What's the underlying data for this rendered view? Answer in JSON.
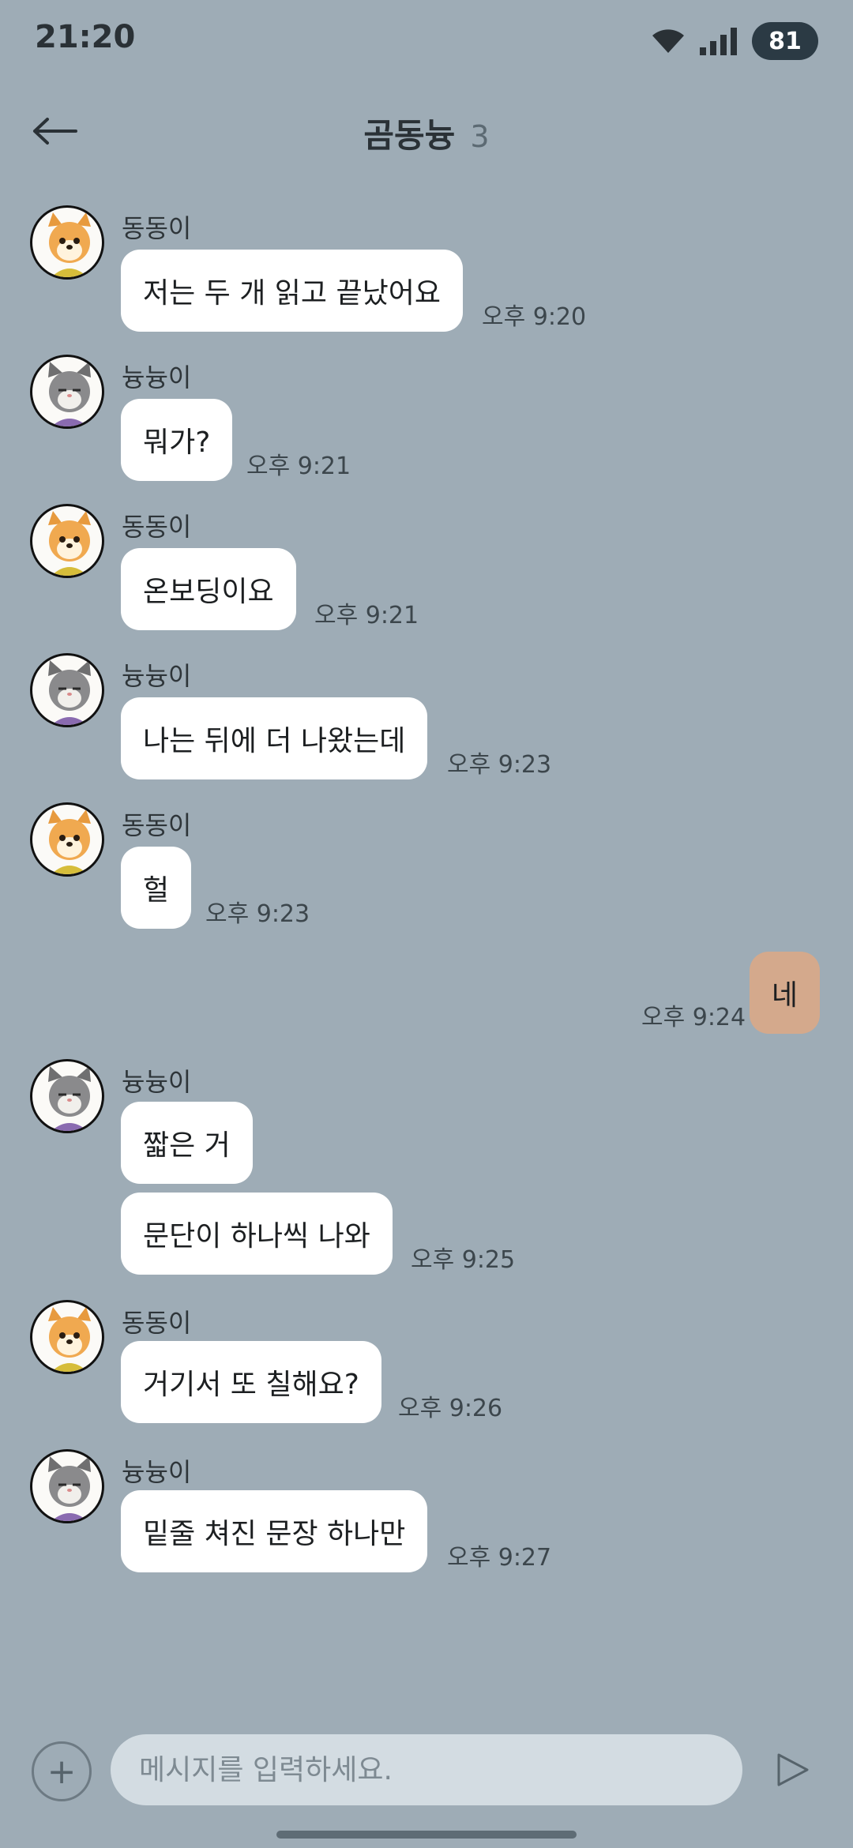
{
  "status_bar": {
    "time": "21:20",
    "battery": "81",
    "icons": [
      "wifi-icon",
      "signal-icon",
      "battery-icon"
    ]
  },
  "header": {
    "back_icon": "arrow-left-icon",
    "title": "곰동늉",
    "member_count": "3"
  },
  "messages": [
    {
      "sender": "동동이",
      "avatar": "dog",
      "text": "저는 두 개 읽고 끝났어요",
      "time": "오후 9:20"
    },
    {
      "sender": "늉늉이",
      "avatar": "cat",
      "text": "뭐가?",
      "time": "오후 9:21"
    },
    {
      "sender": "동동이",
      "avatar": "dog",
      "text": "온보딩이요",
      "time": "오후 9:21"
    },
    {
      "sender": "늉늉이",
      "avatar": "cat",
      "text": "나는 뒤에 더 나왔는데",
      "time": "오후 9:23"
    },
    {
      "sender": "동동이",
      "avatar": "dog",
      "text": "헐",
      "time": "오후 9:23"
    },
    {
      "sender": "me",
      "text": "네",
      "time": "오후 9:24"
    },
    {
      "sender": "늉늉이",
      "avatar": "cat",
      "text": "짧은 거",
      "time": ""
    },
    {
      "sender": "늉늉이",
      "avatar": "cat",
      "text": "문단이 하나씩 나와",
      "time": "오후 9:25"
    },
    {
      "sender": "동동이",
      "avatar": "dog",
      "text": "거기서 또 칠해요?",
      "time": "오후 9:26"
    },
    {
      "sender": "늉늉이",
      "avatar": "cat",
      "text": "밑줄 쳐진 문장 하나만",
      "time": "오후 9:27"
    }
  ],
  "composer": {
    "plus_label": "+",
    "placeholder": "메시지를 입력하세요.",
    "send_icon": "send-icon"
  },
  "colors": {
    "background": "#9eacb6",
    "my_bubble": "#d4a98c",
    "other_bubble": "#ffffff",
    "input_bg": "#d3dce2"
  }
}
